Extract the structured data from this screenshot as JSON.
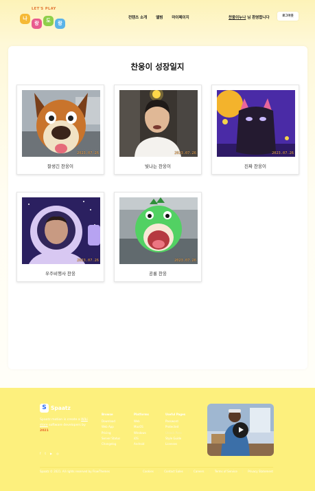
{
  "header": {
    "logo_tag": "LET'S PLAY",
    "logo_letters": [
      "나",
      "랑",
      "도",
      "랑"
    ],
    "nav": [
      "컨텐츠 소개",
      "앨범",
      "마이페이지"
    ],
    "user_name": "찬웅이누나",
    "greeting_suffix": "님 환영합니다",
    "logout_label": "로그아웃"
  },
  "page_title": "찬웅이 성장일지",
  "cards": [
    {
      "caption": "잘생긴 찬웅이",
      "date": "2023.07.26"
    },
    {
      "caption": "빛나는 찬웅이",
      "date": "2023.07.26"
    },
    {
      "caption": "진짜 찬웅이",
      "date": "2023.07.26"
    },
    {
      "caption": "우주비행사 찬웅",
      "date": "2023.07.26"
    },
    {
      "caption": "공룡 찬웅",
      "date": "2023.07.26"
    }
  ],
  "footer": {
    "brand": "Spaatz",
    "desc_1": "Spaatz motion is create a",
    "desc_link": "Wiki store",
    "desc_2": "software",
    "desc_3": "developers by",
    "desc_year": "2021",
    "social_icons": [
      "facebook-icon",
      "twitter-icon",
      "youtube-icon",
      "instagram-icon"
    ],
    "columns": [
      {
        "title": "Browse",
        "items": [
          "Download",
          "Web App",
          "Pricing",
          "Server Status",
          "Changelog"
        ]
      },
      {
        "title": "Platforms",
        "items": [
          "Web",
          "MacOS",
          "Windows",
          "iOS",
          "Android"
        ]
      },
      {
        "title": "Useful Pages",
        "items": [
          "Password",
          "Protected",
          "Unlock Pass",
          "Style Guide",
          "Licenses"
        ]
      }
    ],
    "copyright": "Spaatz © 2021. All rights reserved by FlowThemes",
    "bottom_links": [
      "Cookies",
      "Contact Sales",
      "Careers",
      "Terms of Service",
      "Privacy Statement"
    ]
  },
  "colors": {
    "footer_bg": "#fdf07d",
    "accent_orange": "#e8642a",
    "date_stamp": "#ffb35a"
  }
}
